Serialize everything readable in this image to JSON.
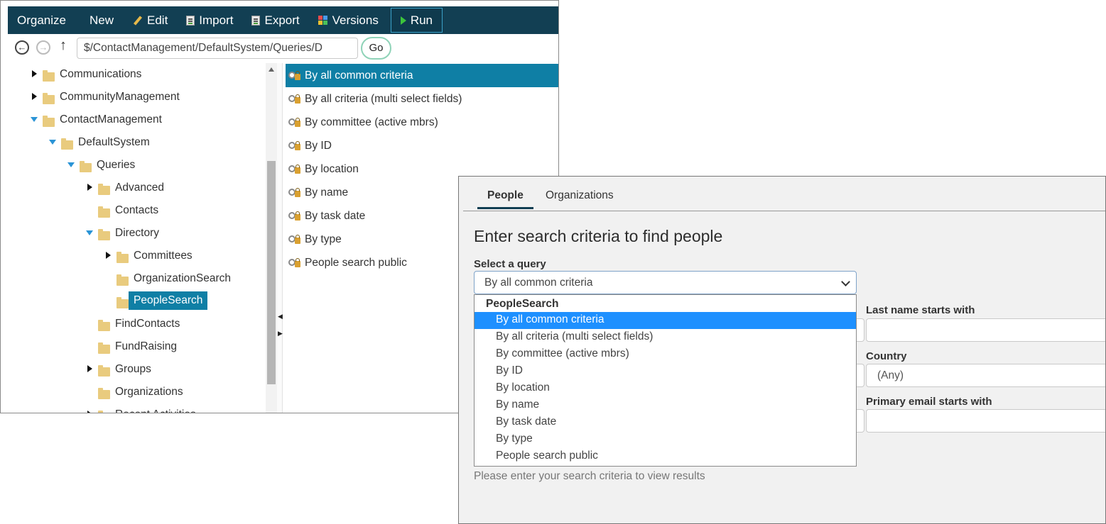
{
  "toolbar": {
    "organize": "Organize",
    "new": "New",
    "edit": "Edit",
    "import": "Import",
    "export": "Export",
    "versions": "Versions",
    "run": "Run"
  },
  "nav": {
    "path": "$/ContactManagement/DefaultSystem/Queries/D",
    "go": "Go"
  },
  "tree": {
    "items": [
      {
        "label": "Communications",
        "state": "collapsed"
      },
      {
        "label": "CommunityManagement",
        "state": "collapsed"
      },
      {
        "label": "ContactManagement",
        "state": "expanded"
      },
      {
        "label": "DefaultSystem",
        "state": "expanded"
      },
      {
        "label": "Queries",
        "state": "expanded"
      },
      {
        "label": "Advanced",
        "state": "collapsed"
      },
      {
        "label": "Contacts",
        "state": "leaf"
      },
      {
        "label": "Directory",
        "state": "expanded"
      },
      {
        "label": "Committees",
        "state": "collapsed"
      },
      {
        "label": "OrganizationSearch",
        "state": "leaf"
      },
      {
        "label": "PeopleSearch",
        "state": "selected"
      },
      {
        "label": "FindContacts",
        "state": "leaf"
      },
      {
        "label": "FundRaising",
        "state": "leaf"
      },
      {
        "label": "Groups",
        "state": "collapsed"
      },
      {
        "label": "Organizations",
        "state": "leaf"
      },
      {
        "label": "Recent Activities",
        "state": "collapsed"
      }
    ]
  },
  "queries": {
    "items": [
      "By all common criteria",
      "By all criteria (multi select fields)",
      "By committee (active mbrs)",
      "By ID",
      "By location",
      "By name",
      "By task date",
      "By type",
      "People search public"
    ],
    "selected_index": 0
  },
  "search": {
    "tabs": [
      "People",
      "Organizations"
    ],
    "active_tab": "People",
    "heading": "Enter search criteria to find people",
    "select_label": "Select a query",
    "selected_query": "By all common criteria",
    "dropdown": {
      "group": "PeopleSearch",
      "options": [
        "By all common criteria",
        "By all criteria (multi select fields)",
        "By committee (active mbrs)",
        "By ID",
        "By location",
        "By name",
        "By task date",
        "By type",
        "People search public"
      ],
      "highlighted_index": 0
    },
    "last_name_label": "Last name starts with",
    "last_name_value": "",
    "country_label": "Country",
    "country_value": "(Any)",
    "email_label": "Primary email starts with",
    "email_value": "",
    "hint": "Please enter your search criteria to view results"
  }
}
